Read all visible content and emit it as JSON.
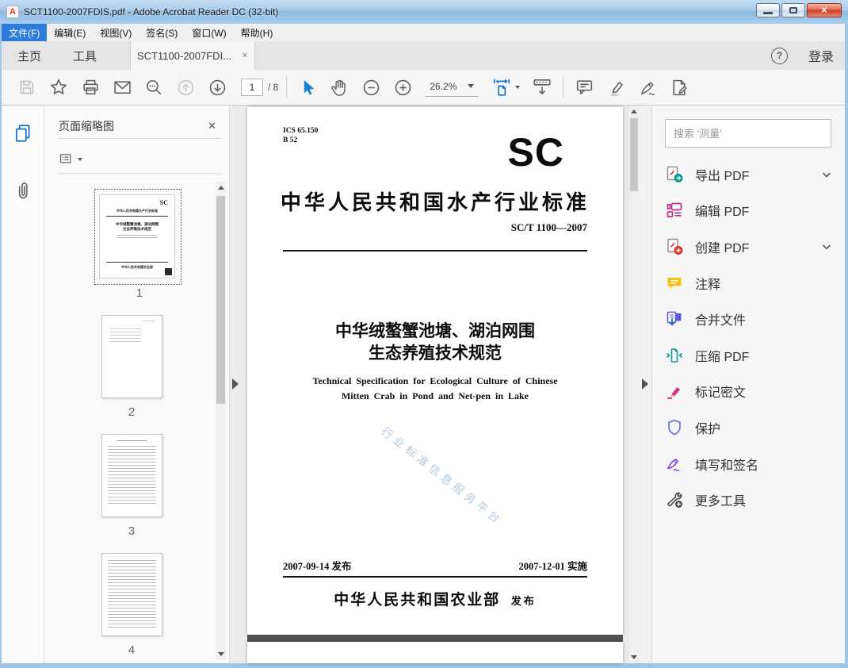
{
  "window": {
    "title": "SCT1100-2007FDIS.pdf - Adobe Acrobat Reader DC (32-bit)"
  },
  "menubar": {
    "items": [
      {
        "label": "文件(F)",
        "active": true
      },
      {
        "label": "编辑(E)",
        "active": false
      },
      {
        "label": "视图(V)",
        "active": false
      },
      {
        "label": "签名(S)",
        "active": false
      },
      {
        "label": "窗口(W)",
        "active": false
      },
      {
        "label": "帮助(H)",
        "active": false
      }
    ]
  },
  "tabbar": {
    "home": "主页",
    "tools": "工具",
    "document_tab": "SCT1100-2007FDI...",
    "close_glyph": "✕",
    "help_glyph": "?",
    "sign_in": "登录"
  },
  "toolbar": {
    "page_current": "1",
    "page_total": "/ 8",
    "zoom_level": "26.2%"
  },
  "left_panel": {
    "title": "页面缩略图",
    "close_glyph": "✕",
    "thumbnails": [
      {
        "num": "1",
        "selected": true
      },
      {
        "num": "2",
        "selected": false
      },
      {
        "num": "3",
        "selected": false
      },
      {
        "num": "4",
        "selected": false
      }
    ]
  },
  "document": {
    "ics_line1": "ICS 65.150",
    "ics_line2": "B 52",
    "logo": "SC",
    "heading": "中华人民共和国水产行业标准",
    "std_no": "SC/T 1100—2007",
    "title_line1": "中华绒螯蟹池塘、湖泊网围",
    "title_line2": "生态养殖技术规范",
    "en_line1": "Technical Specification for Ecological Culture of Chinese",
    "en_line2": "Mitten Crab in Pond and Net-pen in Lake",
    "watermark": "行业标准信息服务平台",
    "issue_date": "2007-09-14 发布",
    "impl_date": "2007-12-01 实施",
    "publisher": "中华人民共和国农业部",
    "publisher_suffix": "发布"
  },
  "right_panel": {
    "search_placeholder": "搜索 '测量'",
    "tools": [
      {
        "label": "导出 PDF",
        "icon": "export-pdf-icon",
        "expandable": true
      },
      {
        "label": "编辑 PDF",
        "icon": "edit-pdf-icon",
        "expandable": false
      },
      {
        "label": "创建 PDF",
        "icon": "create-pdf-icon",
        "expandable": true
      },
      {
        "label": "注释",
        "icon": "comment-icon",
        "expandable": false
      },
      {
        "label": "合并文件",
        "icon": "combine-files-icon",
        "expandable": false
      },
      {
        "label": "压缩 PDF",
        "icon": "compress-pdf-icon",
        "expandable": false
      },
      {
        "label": "标记密文",
        "icon": "redact-icon",
        "expandable": false
      },
      {
        "label": "保护",
        "icon": "protect-icon",
        "expandable": false
      },
      {
        "label": "填写和签名",
        "icon": "fill-sign-icon",
        "expandable": false
      },
      {
        "label": "更多工具",
        "icon": "more-tools-icon",
        "expandable": false
      }
    ]
  },
  "colors": {
    "menu_highlight": "#2e7bd9",
    "accent_blue": "#1272c9",
    "export_teal": "#0ea08c",
    "create_red": "#d63a2f",
    "edit_magenta": "#c2308e",
    "comment_yellow": "#f3c117",
    "combine_purple": "#5f5bd7",
    "compress_teal": "#11998e",
    "redact_pink": "#d63384",
    "protect_indigo": "#6b74e0",
    "fillsign_purple": "#7c3fd4",
    "page_gap_gray": "#515151"
  }
}
